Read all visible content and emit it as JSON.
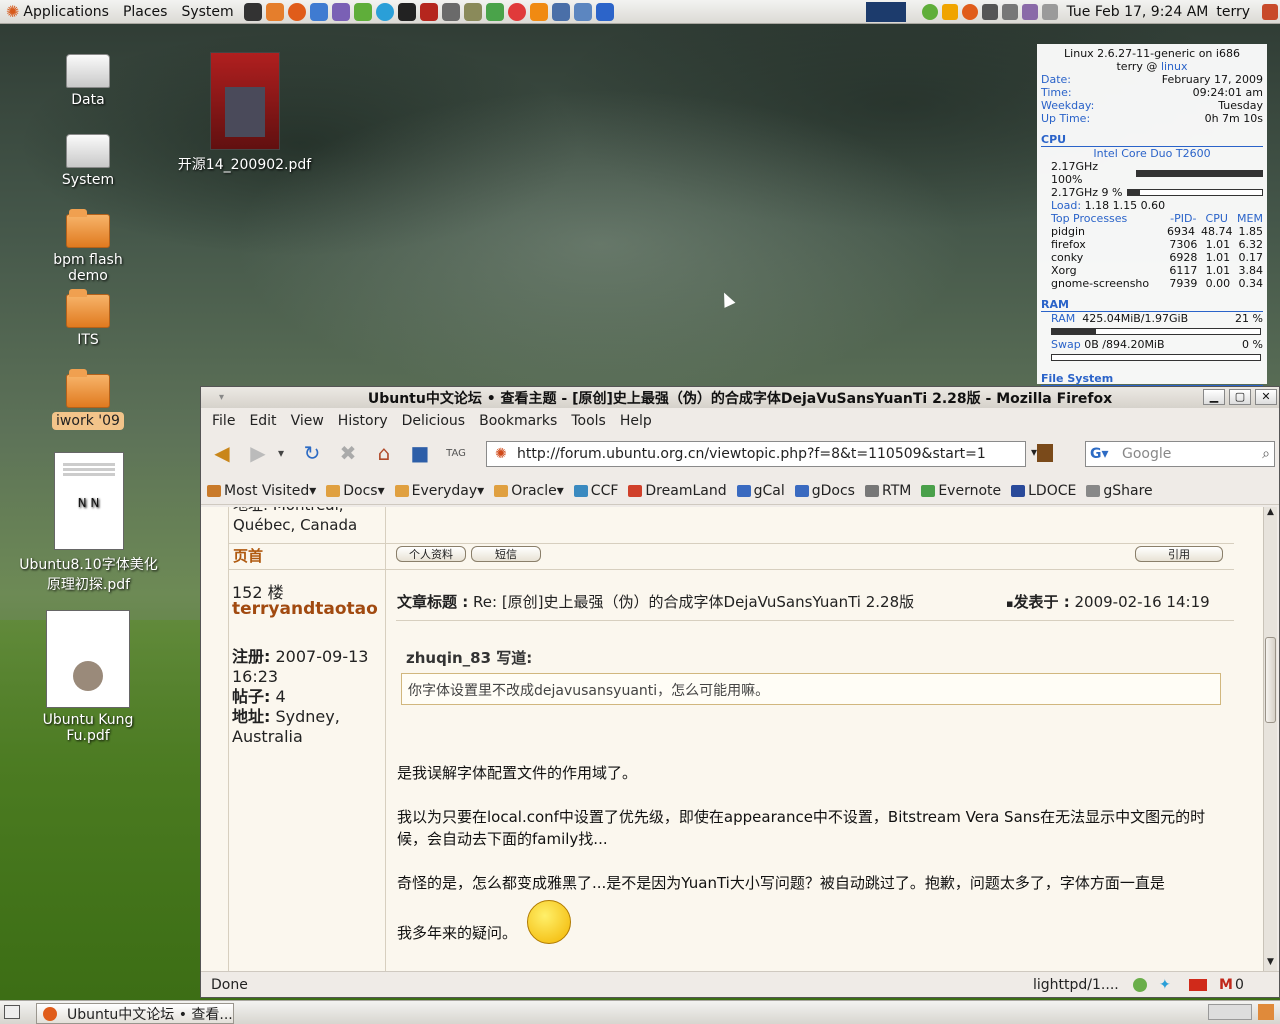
{
  "top_panel": {
    "menus": [
      "Applications",
      "Places",
      "System"
    ],
    "clock": "Tue Feb 17,  9:24 AM",
    "user": "terry"
  },
  "desktop": {
    "icons": [
      {
        "label": "Data",
        "kind": "drive"
      },
      {
        "label": "System",
        "kind": "drive"
      },
      {
        "label": "bpm flash demo",
        "kind": "folder"
      },
      {
        "label": "ITS",
        "kind": "folder"
      },
      {
        "label": "iwork '09",
        "kind": "folder"
      },
      {
        "label": "Ubuntu8.10字体美化原理初探.pdf",
        "kind": "pdf"
      },
      {
        "label": "Ubuntu Kung Fu.pdf",
        "kind": "pdf"
      },
      {
        "label": "开源14_200902.pdf",
        "kind": "pdf"
      }
    ]
  },
  "conky": {
    "kernel": "Linux 2.6.27-11-generic on i686",
    "user_host_prefix": "terry @",
    "host": "linux",
    "rows": [
      {
        "k": "Date:",
        "v": "February 17, 2009"
      },
      {
        "k": "Time:",
        "v": "09:24:01 am"
      },
      {
        "k": "Weekday:",
        "v": "Tuesday"
      },
      {
        "k": "Up Time:",
        "v": "0h 7m 10s"
      }
    ],
    "cpu_heading": "CPU",
    "cpu_model": "Intel Core Duo T2600",
    "cpu1": "2.17GHz 100%",
    "cpu1_level": 1.0,
    "cpu2": "2.17GHz 9  %",
    "cpu2_level": 0.09,
    "load_label": "Load:",
    "load": "1.18 1.15 0.60",
    "top_heading": [
      "Top Processes",
      "-PID-",
      "CPU",
      "MEM"
    ],
    "procs": [
      [
        "pidgin",
        "6934",
        "48.74",
        "1.85"
      ],
      [
        "firefox",
        "7306",
        "1.01",
        "6.32"
      ],
      [
        "conky",
        "6928",
        "1.01",
        "0.17"
      ],
      [
        "Xorg",
        "6117",
        "1.01",
        "3.84"
      ],
      [
        "gnome-screensho",
        "7939",
        "0.00",
        "0.34"
      ]
    ],
    "ram_heading": "RAM",
    "ram_label": "RAM",
    "ram_value": "425.04MiB/1.97GiB",
    "ram_pct": "21 %",
    "ram_level": 0.21,
    "swap_label": "Swap",
    "swap_value": "0B      /894.20MiB",
    "swap_pct": "0  %",
    "swap_level": 0,
    "fs_heading": "File System"
  },
  "firefox": {
    "title": "Ubuntu中文论坛 • 查看主题 - [原创]史上最强（伪）的合成字体DejaVuSansYuanTi 2.28版 - Mozilla Firefox",
    "menu": [
      "File",
      "Edit",
      "View",
      "History",
      "Delicious",
      "Bookmarks",
      "Tools",
      "Help"
    ],
    "url": "http://forum.ubuntu.org.cn/viewtopic.php?f=8&t=110509&start=1",
    "search_placeholder": "Google",
    "bookmarks": [
      "Most Visited",
      "Docs",
      "Everyday",
      "Oracle",
      "CCF",
      "DreamLand",
      "gCal",
      "gDocs",
      "RTM",
      "Evernote",
      "LDOCE",
      "gShare"
    ],
    "status": "Done",
    "status_right": "lighttpd/1....",
    "mail_count": "0"
  },
  "forum": {
    "prev_location": "地址: Montréal, Québec, Canada",
    "prev_location_1": "地址: Montréal,",
    "prev_location_2": "Québec, Canada",
    "top_link": "页首",
    "btn_profile": "个人资料",
    "btn_pm": "短信",
    "btn_quote": "引用",
    "floor": "152 楼",
    "author": "terryandtaotao",
    "subject_label": "文章标题 :",
    "subject": "Re: [原创]史上最强（伪）的合成字体DejaVuSansYuanTi 2.28版",
    "posted_label": "发表于 :",
    "posted": "2009-02-16 14:19",
    "reg_label": "注册:",
    "reg_date": "2007-09-13",
    "reg_time": "16:23",
    "posts_label": "帖子:",
    "posts": "4",
    "loc_label": "地址:",
    "loc_1": "Sydney,",
    "loc_2": "Australia",
    "quote_author": "zhuqin_83 写道:",
    "quote_text": "你字体设置里不改成dejavusansyuanti，怎么可能用嘛。",
    "p1": "是我误解字体配置文件的作用域了。",
    "p2": "我以为只要在local.conf中设置了优先级，即使在appearance中不设置，Bitstream Vera Sans在无法显示中文图元的时候，会自动去下面的family找...",
    "p3": "奇怪的是，怎么都变成雅黑了...是不是因为YuanTi大小写问题？被自动跳过了。抱歉，问题太多了，字体方面一直是",
    "p4": "我多年来的疑问。"
  },
  "taskbar": {
    "item": "Ubuntu中文论坛 • 查看..."
  }
}
